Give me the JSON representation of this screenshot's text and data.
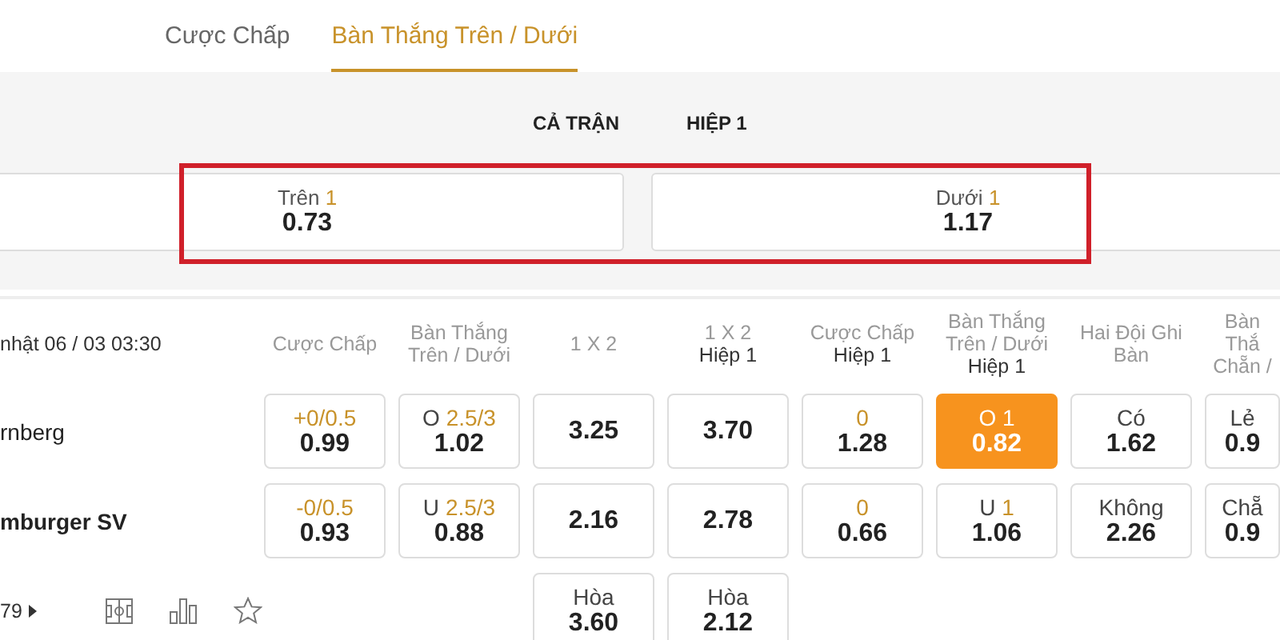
{
  "market_tabs": [
    {
      "label": "Cược Chấp",
      "selected": false
    },
    {
      "label": "Bàn Thắng Trên / Dưới",
      "selected": true
    }
  ],
  "period_tabs": [
    {
      "label": "CẢ TRẬN"
    },
    {
      "label": "HIỆP 1"
    }
  ],
  "options": [
    {
      "label": "Trên",
      "line": "1",
      "odds": "0.73"
    },
    {
      "label": "Dưới",
      "line": "1",
      "odds": "1.17"
    }
  ],
  "highlight": true,
  "table": {
    "time": "nhật 06 / 03 03:30",
    "columns": [
      {
        "lines": [
          "Cược Chấp"
        ]
      },
      {
        "lines": [
          "Bàn Thắng",
          "Trên / Dưới"
        ]
      },
      {
        "lines": [
          "1 X 2"
        ]
      },
      {
        "lines": [
          "1 X 2"
        ],
        "sub": "Hiệp 1"
      },
      {
        "lines": [
          "Cược Chấp"
        ],
        "sub": "Hiệp 1"
      },
      {
        "lines": [
          "Bàn Thắng",
          "Trên / Dưới"
        ],
        "sub": "Hiệp 1"
      },
      {
        "lines": [
          "Hai Đội Ghi",
          "Bàn"
        ]
      },
      {
        "lines": [
          "Bàn Thắ",
          "Chẵn /"
        ]
      }
    ],
    "rows": [
      {
        "team": "rnberg",
        "bold": false,
        "cells": [
          {
            "line": "+0/0.5",
            "odds": "0.99",
            "selected": false
          },
          {
            "label": "O",
            "line": "2.5/3",
            "odds": "1.02",
            "selected": false
          },
          {
            "odds": "3.25",
            "selected": false
          },
          {
            "odds": "3.70",
            "selected": false
          },
          {
            "line": "0",
            "odds": "1.28",
            "selected": false
          },
          {
            "label": "O",
            "line": "1",
            "odds": "0.82",
            "selected": true
          },
          {
            "label": "Có",
            "odds": "1.62",
            "selected": false
          },
          {
            "label": "Lẻ",
            "odds": "0.9",
            "selected": false
          }
        ]
      },
      {
        "team": "mburger SV",
        "bold": true,
        "cells": [
          {
            "line": "-0/0.5",
            "odds": "0.93",
            "selected": false
          },
          {
            "label": "U",
            "line": "2.5/3",
            "odds": "0.88",
            "selected": false
          },
          {
            "odds": "2.16",
            "selected": false
          },
          {
            "odds": "2.78",
            "selected": false
          },
          {
            "line": "0",
            "odds": "0.66",
            "selected": false
          },
          {
            "label": "U",
            "line": "1",
            "odds": "1.06",
            "selected": false
          },
          {
            "label": "Không",
            "odds": "2.26",
            "selected": false
          },
          {
            "label": "Chẵ",
            "odds": "0.9",
            "selected": false
          }
        ]
      },
      {
        "count": "79",
        "cells": [
          null,
          null,
          {
            "label": "Hòa",
            "odds": "3.60",
            "selected": false
          },
          {
            "label": "Hòa",
            "odds": "2.12",
            "selected": false
          },
          null,
          null,
          null,
          null
        ]
      }
    ]
  }
}
